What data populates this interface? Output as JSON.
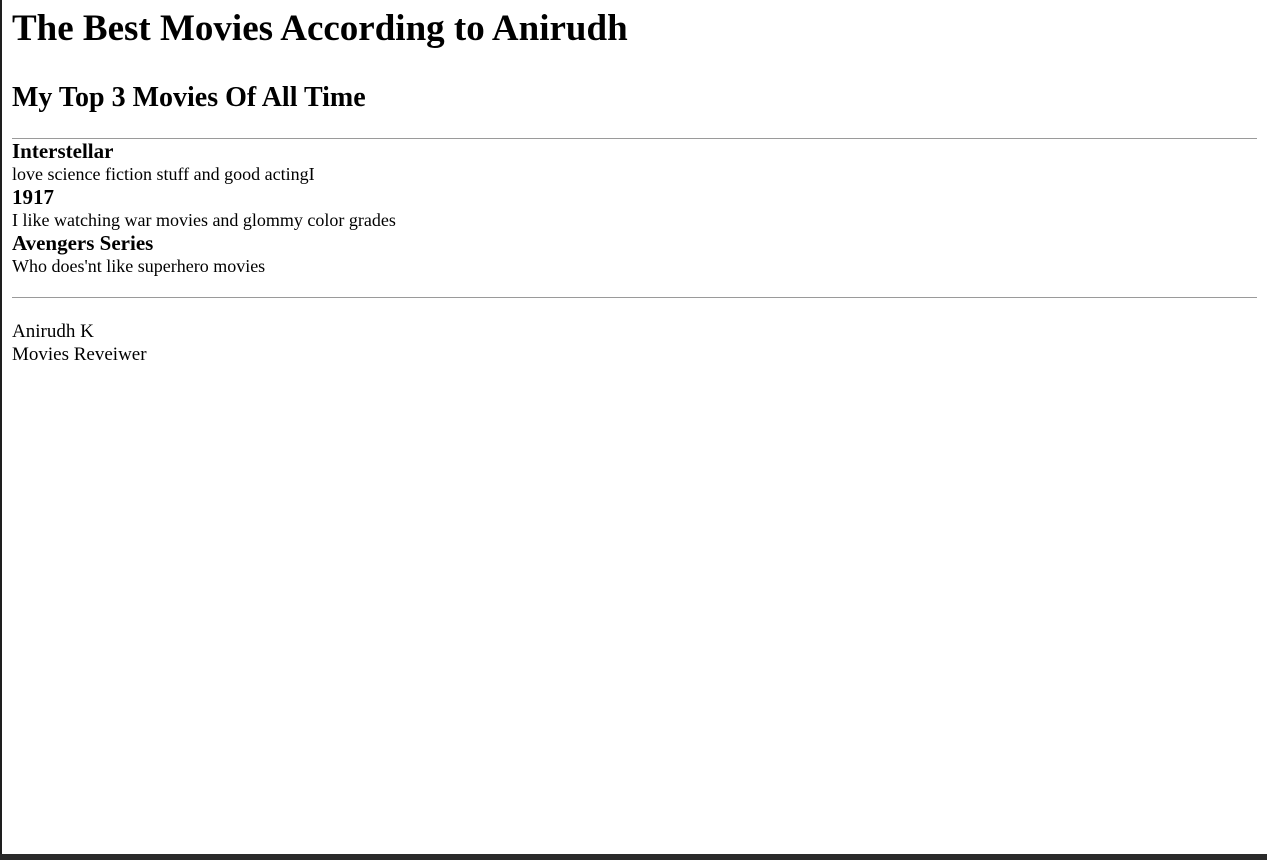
{
  "header": {
    "title": "The Best Movies According to Anirudh",
    "subtitle": "My Top 3 Movies Of All Time"
  },
  "movies": [
    {
      "title": "Interstellar",
      "description": "love science fiction stuff and good actingI"
    },
    {
      "title": "1917",
      "description": "I like watching war movies and glommy color grades"
    },
    {
      "title": "Avengers Series",
      "description": "Who does'nt like superhero movies"
    }
  ],
  "footer": {
    "name": "Anirudh K",
    "role": "Movies Reveiwer"
  },
  "colors": {
    "page_background": "#ffffff",
    "text": "#000000",
    "divider": "#9a9a9a",
    "window_frame": "#1e1e1e"
  }
}
